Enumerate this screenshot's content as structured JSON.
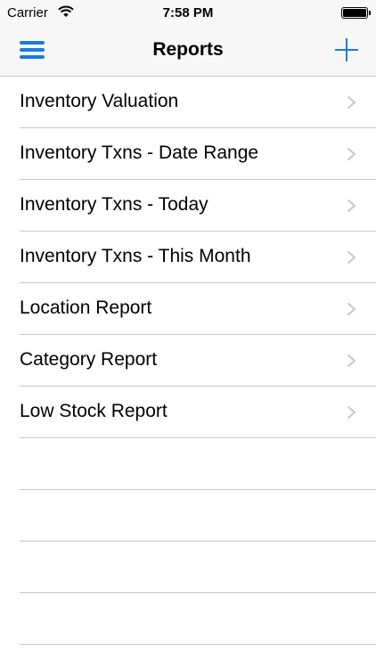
{
  "status_bar": {
    "carrier": "Carrier",
    "time": "7:58 PM",
    "wifi_icon": "wifi-icon",
    "battery_icon": "battery-icon"
  },
  "nav_bar": {
    "title": "Reports",
    "menu_icon": "hamburger-menu-icon",
    "add_icon": "plus-icon"
  },
  "reports": [
    {
      "label": "Inventory Valuation"
    },
    {
      "label": "Inventory Txns - Date Range"
    },
    {
      "label": "Inventory Txns - Today"
    },
    {
      "label": "Inventory Txns - This Month"
    },
    {
      "label": "Location Report"
    },
    {
      "label": "Category Report"
    },
    {
      "label": "Low Stock Report"
    }
  ],
  "colors": {
    "accent": "#1a7be0",
    "separator": "#c8c7cc",
    "chevron": "#c7c7cc",
    "bar_background": "#f7f7f7"
  }
}
